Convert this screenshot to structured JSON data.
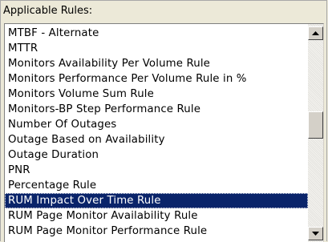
{
  "panel": {
    "title": "Applicable Rules:"
  },
  "rules_list": {
    "items": [
      "MTBF - Alternate",
      "MTTR",
      "Monitors Availability Per Volume Rule",
      "Monitors Performance Per Volume Rule in %",
      "Monitors Volume Sum Rule",
      "Monitors-BP Step Performance Rule",
      "Number Of Outages",
      "Outage Based on Availability",
      "Outage Duration",
      "PNR",
      "Percentage Rule",
      "RUM Impact Over Time Rule",
      "RUM Page Monitor Availability Rule",
      "RUM Page Monitor Performance Rule"
    ],
    "selected_index": 11,
    "selected_label": "RUM Impact Over Time Rule"
  },
  "scrollbar": {
    "up_icon": "arrow-up-icon",
    "down_icon": "arrow-down-icon"
  },
  "colors": {
    "selection_background": "#0a246a",
    "selection_text": "#ffffff",
    "panel_background": "#ece9d8"
  }
}
